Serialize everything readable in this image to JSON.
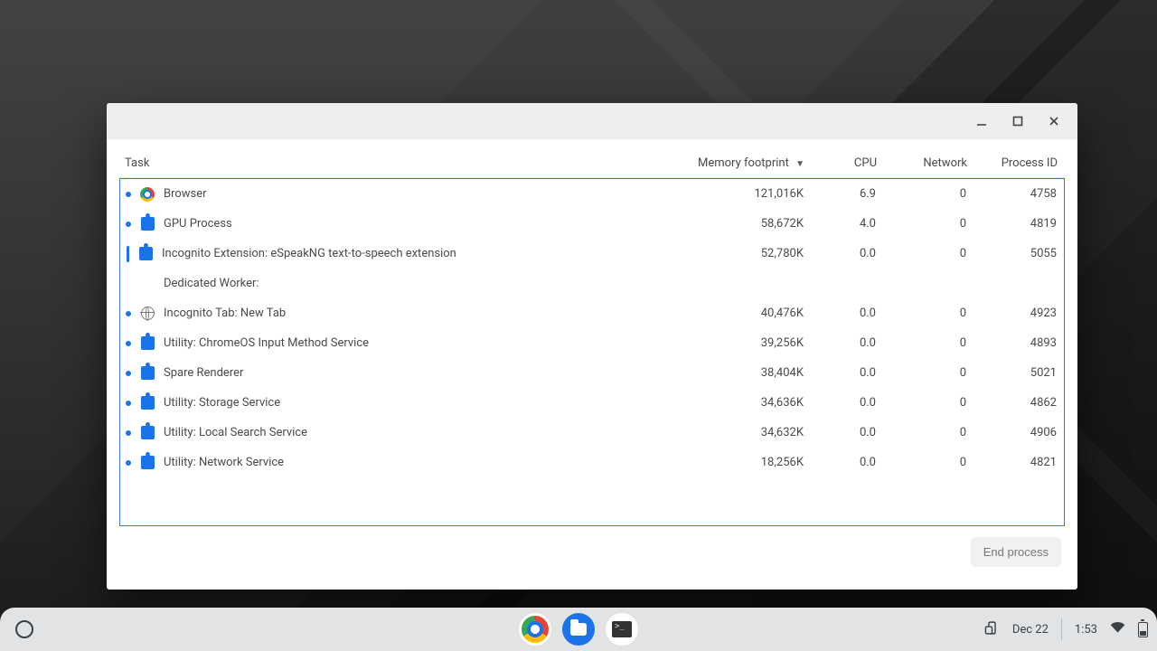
{
  "columns": {
    "task": "Task",
    "memory": "Memory footprint",
    "cpu": "CPU",
    "network": "Network",
    "pid": "Process ID"
  },
  "sort_indicator": "▼",
  "rows": [
    {
      "icon": "chrome",
      "name": "Browser",
      "mem": "121,016K",
      "cpu": "6.9",
      "net": "0",
      "pid": "4758",
      "marker": "dot"
    },
    {
      "icon": "puzzle",
      "name": "GPU Process",
      "mem": "58,672K",
      "cpu": "4.0",
      "net": "0",
      "pid": "4819",
      "marker": "dot"
    },
    {
      "icon": "puzzle",
      "name": "Incognito Extension: eSpeakNG text-to-speech extension",
      "mem": "52,780K",
      "cpu": "0.0",
      "net": "0",
      "pid": "5055",
      "marker": "bar"
    },
    {
      "icon": "",
      "name": "Dedicated Worker:",
      "mem": "",
      "cpu": "",
      "net": "",
      "pid": "",
      "marker": ""
    },
    {
      "icon": "globe",
      "name": "Incognito Tab: New Tab",
      "mem": "40,476K",
      "cpu": "0.0",
      "net": "0",
      "pid": "4923",
      "marker": "dot"
    },
    {
      "icon": "puzzle",
      "name": "Utility: ChromeOS Input Method Service",
      "mem": "39,256K",
      "cpu": "0.0",
      "net": "0",
      "pid": "4893",
      "marker": "dot"
    },
    {
      "icon": "puzzle",
      "name": "Spare Renderer",
      "mem": "38,404K",
      "cpu": "0.0",
      "net": "0",
      "pid": "5021",
      "marker": "dot"
    },
    {
      "icon": "puzzle",
      "name": "Utility: Storage Service",
      "mem": "34,636K",
      "cpu": "0.0",
      "net": "0",
      "pid": "4862",
      "marker": "dot"
    },
    {
      "icon": "puzzle",
      "name": "Utility: Local Search Service",
      "mem": "34,632K",
      "cpu": "0.0",
      "net": "0",
      "pid": "4906",
      "marker": "dot"
    },
    {
      "icon": "puzzle",
      "name": "Utility: Network Service",
      "mem": "18,256K",
      "cpu": "0.0",
      "net": "0",
      "pid": "4821",
      "marker": "dot"
    }
  ],
  "end_process_label": "End process",
  "shelf": {
    "date": "Dec 22",
    "time": "1:53"
  }
}
